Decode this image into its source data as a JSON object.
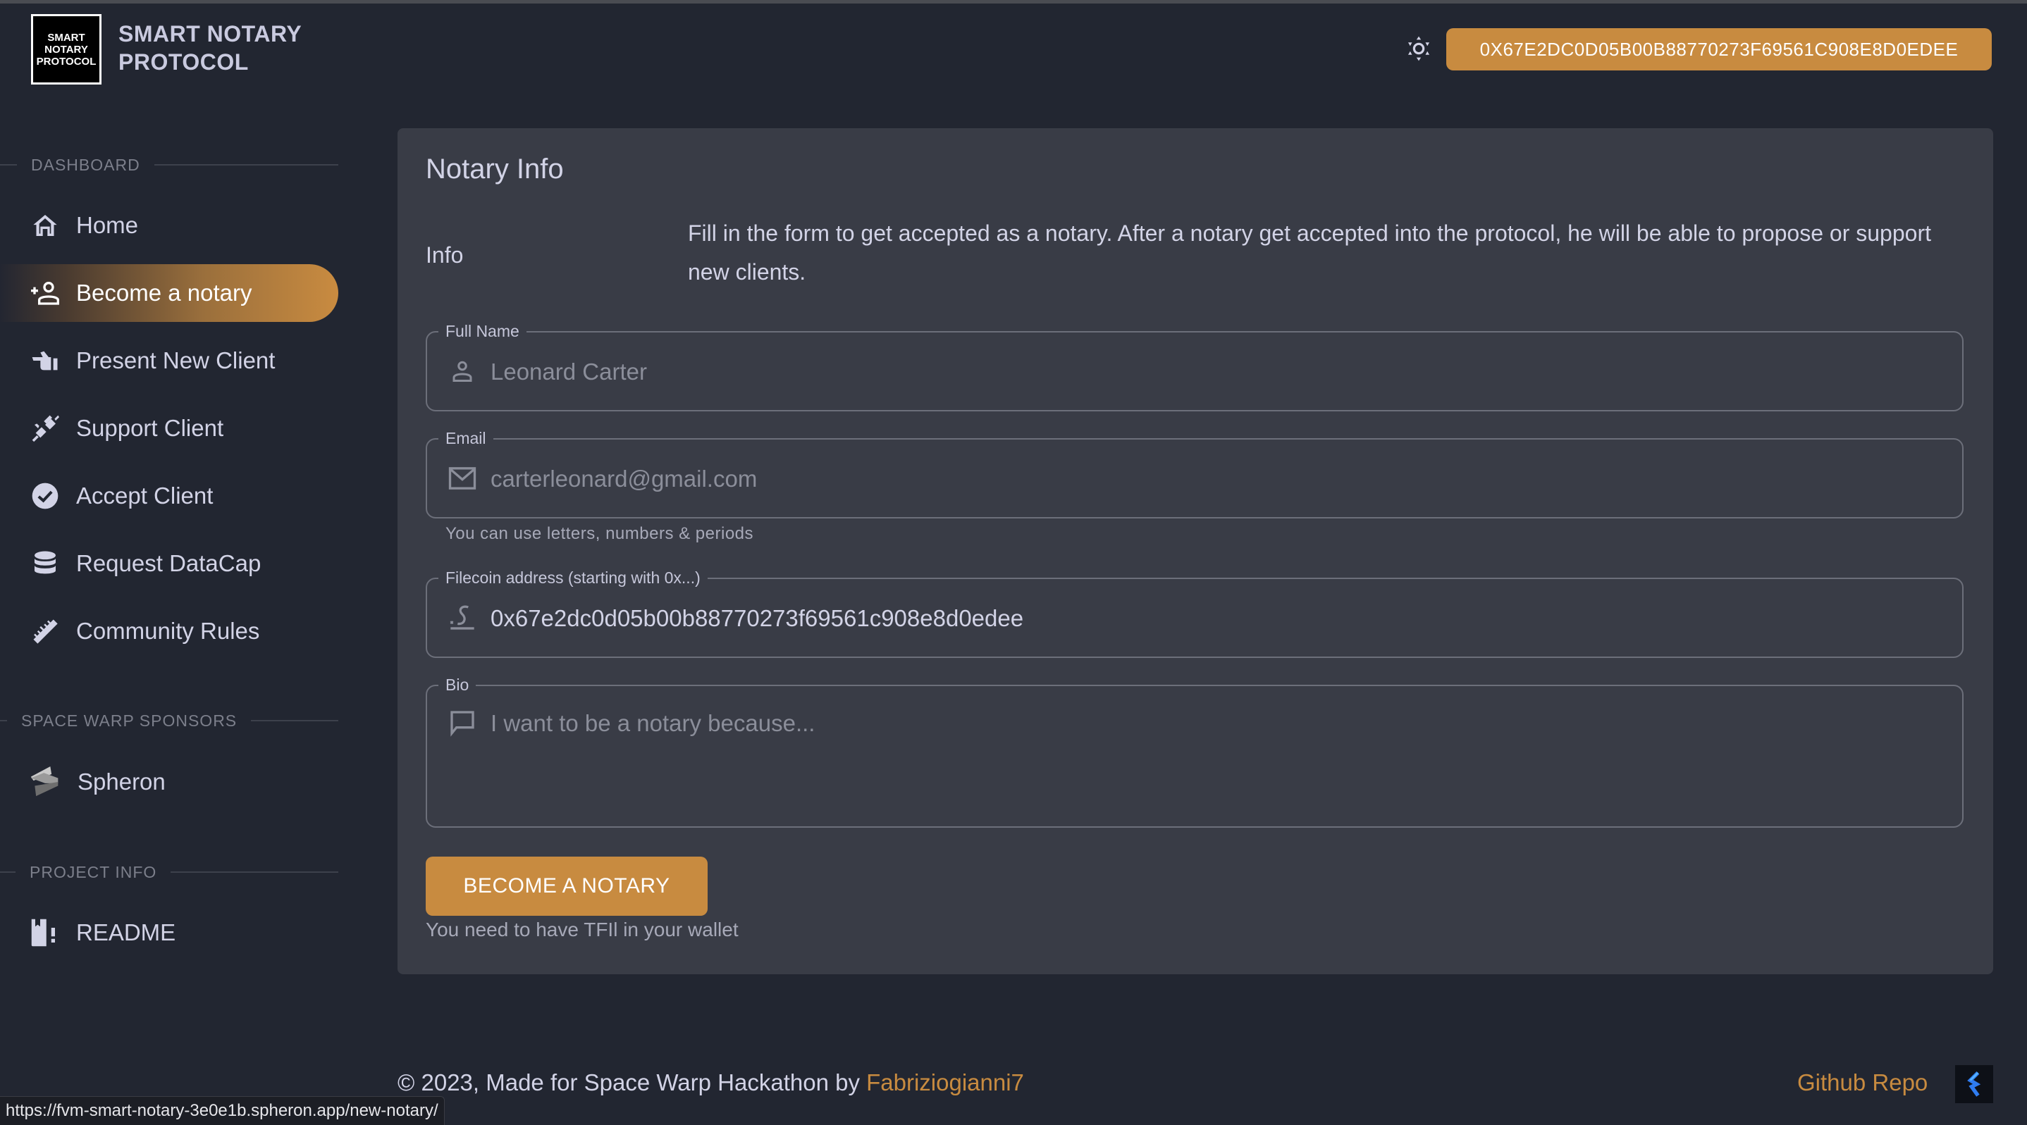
{
  "header": {
    "logo_lines": [
      "SMART",
      "NOTARY",
      "PROTOCOL"
    ],
    "title_lines": [
      "SMART NOTARY",
      "PROTOCOL"
    ],
    "theme_icon": "sun-icon",
    "wallet_address": "0X67E2DC0D05B00B88770273F69561C908E8D0EDEE"
  },
  "sidebar": {
    "sections": [
      {
        "title": "DASHBOARD",
        "items": [
          {
            "label": "Home",
            "icon": "home-icon"
          },
          {
            "label": "Become a notary",
            "icon": "add-person-icon",
            "active": true
          },
          {
            "label": "Present New Client",
            "icon": "pointing-hand-icon"
          },
          {
            "label": "Support Client",
            "icon": "plug-icon"
          },
          {
            "label": "Accept Client",
            "icon": "check-circle-icon"
          },
          {
            "label": "Request DataCap",
            "icon": "database-icon"
          },
          {
            "label": "Community Rules",
            "icon": "ruler-icon"
          }
        ]
      },
      {
        "title": "SPACE WARP SPONSORS",
        "items": [
          {
            "label": "Spheron",
            "icon": "spheron-logo-icon"
          }
        ]
      },
      {
        "title": "PROJECT INFO",
        "items": [
          {
            "label": "README",
            "icon": "readme-book-icon"
          }
        ]
      }
    ]
  },
  "card": {
    "title": "Notary Info",
    "info_label": "Info",
    "info_text": "Fill in the form to get accepted as a notary. After a notary get accepted into the protocol, he will be able to propose or support new clients.",
    "fields": {
      "full_name": {
        "label": "Full Name",
        "value": "",
        "placeholder": "Leonard Carter",
        "icon": "person-icon"
      },
      "email": {
        "label": "Email",
        "value": "",
        "placeholder": "carterleonard@gmail.com",
        "icon": "mail-icon",
        "helper": "You can use letters, numbers & periods"
      },
      "filecoin": {
        "label": "Filecoin address (starting with 0x...)",
        "value": "0x67e2dc0d05b00b88770273f69561c908e8d0edee",
        "icon": "signature-icon"
      },
      "bio": {
        "label": "Bio",
        "value": "",
        "placeholder": "I want to be a notary because...",
        "icon": "comment-icon"
      }
    },
    "submit_label": "BECOME A NOTARY",
    "submit_note": "You need to have TFIl in your wallet"
  },
  "footer": {
    "copyright": "© 2023, Made for Space Warp Hackathon by ",
    "author": "Fabriziogianni7",
    "github": "Github Repo"
  },
  "status_url": "https://fvm-smart-notary-3e0e1b.spheron.app/new-notary/",
  "colors": {
    "accent": "#c88b40",
    "background": "#222631",
    "card": "#393c46",
    "text": "#d2d3e6"
  }
}
